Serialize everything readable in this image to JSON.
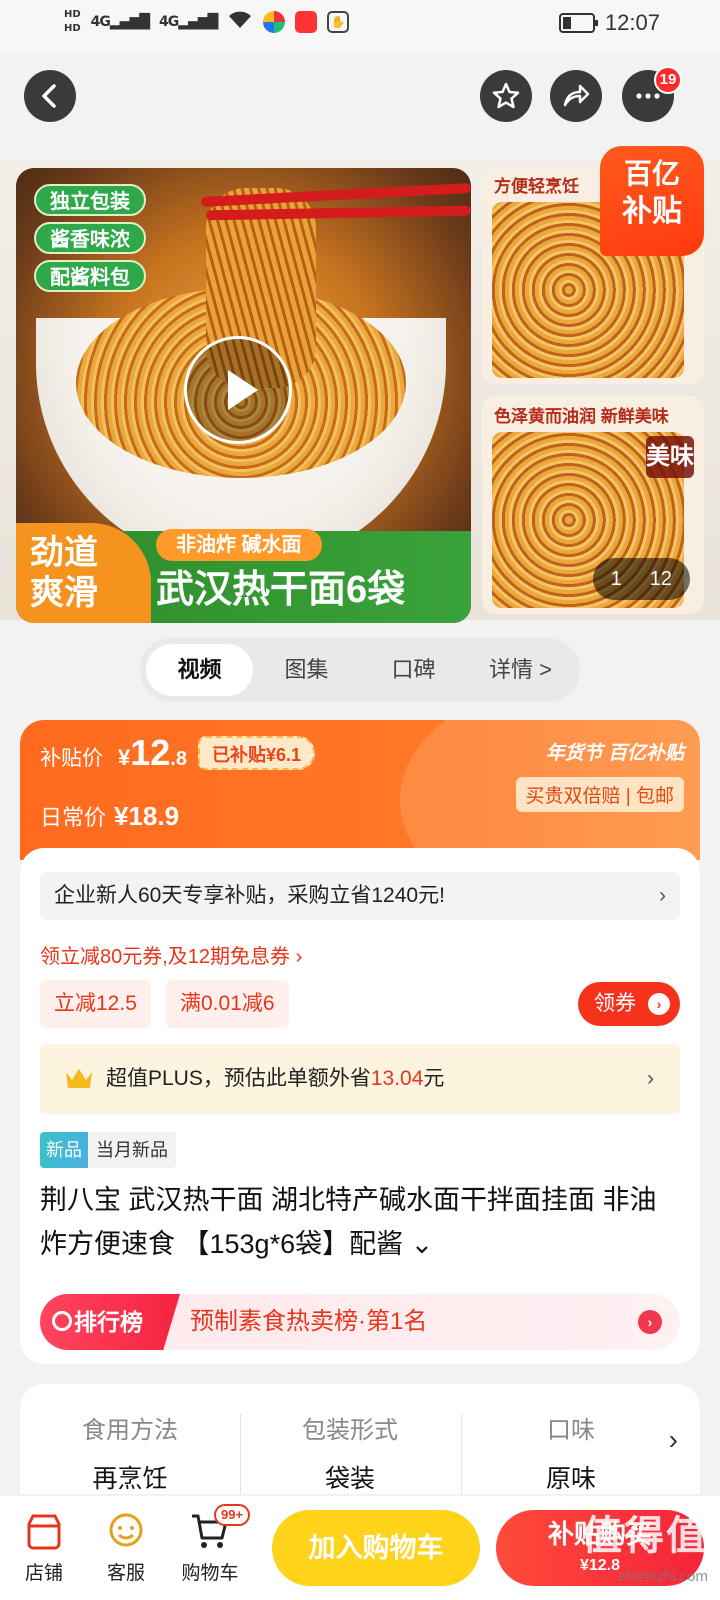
{
  "status_bar": {
    "hd1": "HD",
    "hd2": "HD",
    "net1": "4G",
    "net2": "4G",
    "time": "12:07"
  },
  "header": {
    "cart_badge": "19",
    "icons": [
      "back-icon",
      "star-icon",
      "share-icon",
      "more-icon"
    ]
  },
  "gallery": {
    "tags": [
      "独立包装",
      "酱香味浓",
      "配酱料包"
    ],
    "banner_orange": "劲道爽滑",
    "banner_sub": "非油炸 碱水面",
    "banner_title": "武汉热干面6袋",
    "side1_caption": "方便轻烹饪",
    "side2_caption": "色泽黄而油润 新鲜美味",
    "side2_overlay": "美味",
    "subsidy_line1": "百亿",
    "subsidy_line2": "补贴",
    "counter_current": "1",
    "counter_total": "12"
  },
  "tabs": [
    {
      "label": "视频",
      "active": true
    },
    {
      "label": "图集",
      "active": false
    },
    {
      "label": "口碑",
      "active": false
    },
    {
      "label": "详情 >",
      "active": false
    }
  ],
  "price": {
    "label": "补贴价",
    "currency": "¥",
    "int": "12",
    "dec": ".8",
    "saved": "已补贴¥6.1",
    "daily_label": "日常价",
    "daily_value": "¥18.9",
    "promo_title": "年货节 百亿补贴",
    "promo_sub": "买贵双倍赔 | 包邮"
  },
  "offers": {
    "notice": "企业新人60天专享补贴，采购立省1240元!",
    "coupon_link": "领立减80元券,及12期免息券 ›",
    "pill1": "立减12.5",
    "pill2": "满0.01减6",
    "coupon_button": "领券",
    "plus_prefix": "超值PLUS，预估此单额外省",
    "plus_amount": "13.04",
    "plus_suffix": "元"
  },
  "product": {
    "new_tag": "新品",
    "new_label": "当月新品",
    "title": "荆八宝 武汉热干面 湖北特产碱水面干拌面挂面 非油炸方便速食 【153g*6袋】配酱 ⌄",
    "rank_badge": "排行榜",
    "rank_text": "预制素食热卖榜·第1名"
  },
  "specs": [
    {
      "key": "食用方法",
      "value": "再烹饪"
    },
    {
      "key": "包装形式",
      "value": "袋装"
    },
    {
      "key": "口味",
      "value": "原味"
    }
  ],
  "bottom_bar": {
    "store": "店铺",
    "service": "客服",
    "cart": "购物车",
    "cart_badge": "99+",
    "add_cart": "加入购物车",
    "buy_label": "补贴购买",
    "buy_sub": "¥12.8",
    "watermark": "值得值",
    "watermark_url": "zhizhizhi.com"
  },
  "colors": {
    "accent": "#ff6a1e",
    "red": "#e8361a",
    "yellow": "#ffd31a",
    "green": "#2fa84a"
  }
}
